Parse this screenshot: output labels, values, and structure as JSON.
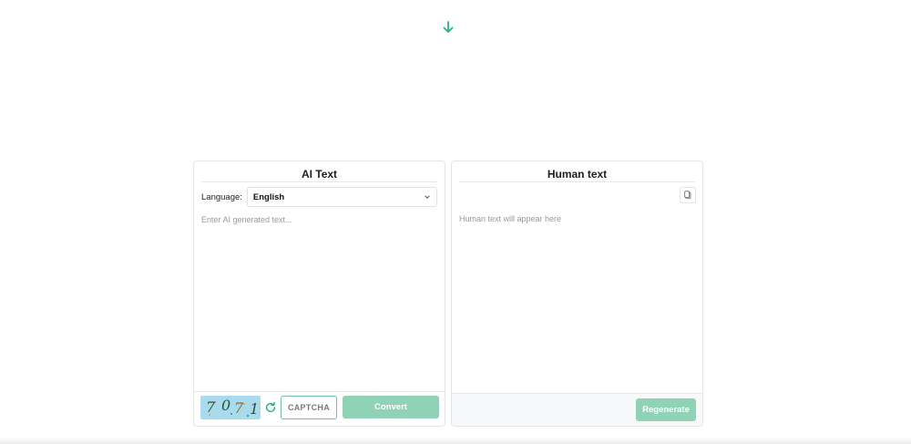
{
  "colors": {
    "accent": "#2bb07f",
    "button_fill": "#8fd2b5",
    "captcha_bg": "#a9dbef",
    "footer_bg": "#f6f8f9"
  },
  "icons": {
    "scroll": "arrow-down-icon",
    "select": "chevron-down-icon",
    "refresh": "refresh-icon",
    "copy": "copy-icon"
  },
  "ai_panel": {
    "title": "AI Text",
    "language_label": "Language:",
    "language_value": "English",
    "input_placeholder": "Enter AI generated text...",
    "captcha_chars": [
      "7",
      "0",
      "7",
      "1"
    ],
    "captcha_placeholder": "CAPTCHA",
    "convert_label": "Convert"
  },
  "human_panel": {
    "title": "Human text",
    "output_placeholder": "Human text will appear here",
    "regenerate_label": "Regenerate"
  }
}
